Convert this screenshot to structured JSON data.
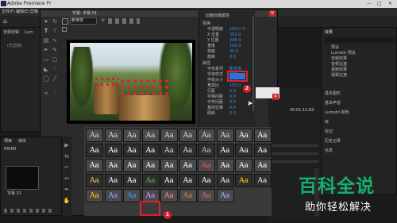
{
  "titlebar": {
    "title": "Adobe Premiere Pr",
    "min": "—",
    "max": "□",
    "close": "✕"
  },
  "menubar": {
    "items": [
      "文件(F)",
      "编辑(E)",
      "剪辑"
    ]
  },
  "left_panel": {
    "tabs": [
      "音频剪辑",
      "Lum"
    ],
    "search_placeholder": "(无剪辑)"
  },
  "font_toolbar": {
    "font_name": "新宋体",
    "size_label": "U"
  },
  "monitor": {
    "header": "字幕: 字幕 01",
    "zoom": "1.0"
  },
  "props_panel": {
    "title": "旧版标题属性",
    "sections": [
      {
        "label": "变换"
      },
      {
        "label": "属性"
      }
    ],
    "rows": [
      {
        "label": "不透明度",
        "value": "100.0 %"
      },
      {
        "label": "X 位置",
        "value": "350.0"
      },
      {
        "label": "Y 位置",
        "value": "248.4"
      },
      {
        "label": "宽度",
        "value": "109.3"
      },
      {
        "label": "高度",
        "value": "36.0"
      },
      {
        "label": "旋转",
        "value": "0.0"
      },
      {
        "label": "字体系列",
        "value": "新宋体"
      },
      {
        "label": "字体样式",
        "value": "常规"
      },
      {
        "label": "字体大小",
        "value": "35.0"
      },
      {
        "label": "宽高比",
        "value": "100.0"
      },
      {
        "label": "行距",
        "value": "0.0"
      },
      {
        "label": "字偶间距",
        "value": "0.0"
      },
      {
        "label": "字符间距",
        "value": "0.0"
      },
      {
        "label": "基线位移",
        "value": "0.0"
      },
      {
        "label": "倾斜",
        "value": "0.0"
      }
    ]
  },
  "right_panel": {
    "header": "效果",
    "tree": [
      "预设",
      "Lumetri 预设",
      "音频效果",
      "音频过渡",
      "视频效果",
      "视频过渡"
    ],
    "sections": [
      "基本图形",
      "基本声音",
      "Lumetri 颜色",
      "库",
      "标记",
      "历史记录",
      "信息"
    ]
  },
  "timeline": {
    "timecode": "00:01:11:00"
  },
  "project_panel": {
    "title": "项目",
    "tab": "媒体",
    "name": "NWRR",
    "clip_name": "字幕 01"
  },
  "styles": {
    "glyph": "Aa",
    "colors": [
      "#d9d9d9",
      "#d9d9d9",
      "#d9d9d9",
      "#d9d9d9",
      "#d9d9d9",
      "#d9d9d9",
      "#d9d9d9",
      "#d9d9d9",
      "#ffffff",
      "#ffffff",
      "#ffffff",
      "#ffffff",
      "#ffffff",
      "#ffffff",
      "#dddddd",
      "#d9d9d9",
      "#c8c8c8",
      "#ffffff",
      "#ffffff",
      "#ffffff",
      "#ffffff",
      "#ffffff",
      "#ffffff",
      "#ffffff",
      "#ffffff",
      "#ffffff",
      "#ff4a4a",
      "#ffffff",
      "#ffffff",
      "#ffffff",
      "#ffd23a",
      "#ffffff",
      "#ffffff",
      "#57b95d",
      "#ffffff",
      "#ffffff",
      "#ffffff",
      "#f0f0f0",
      "#ffd700",
      "#f0f0f0",
      "#ffcc00",
      "#8ab4ff",
      "#3aa0ff",
      "#c9a0ff",
      "#ff8a8a",
      "#d08a4a",
      "#ff5a5a",
      "#8ec0ff"
    ]
  },
  "annotations": {
    "badge1": "1",
    "badge2": "2"
  },
  "watermark": {
    "title": "百科全说",
    "subtitle": "助你轻松解决"
  }
}
